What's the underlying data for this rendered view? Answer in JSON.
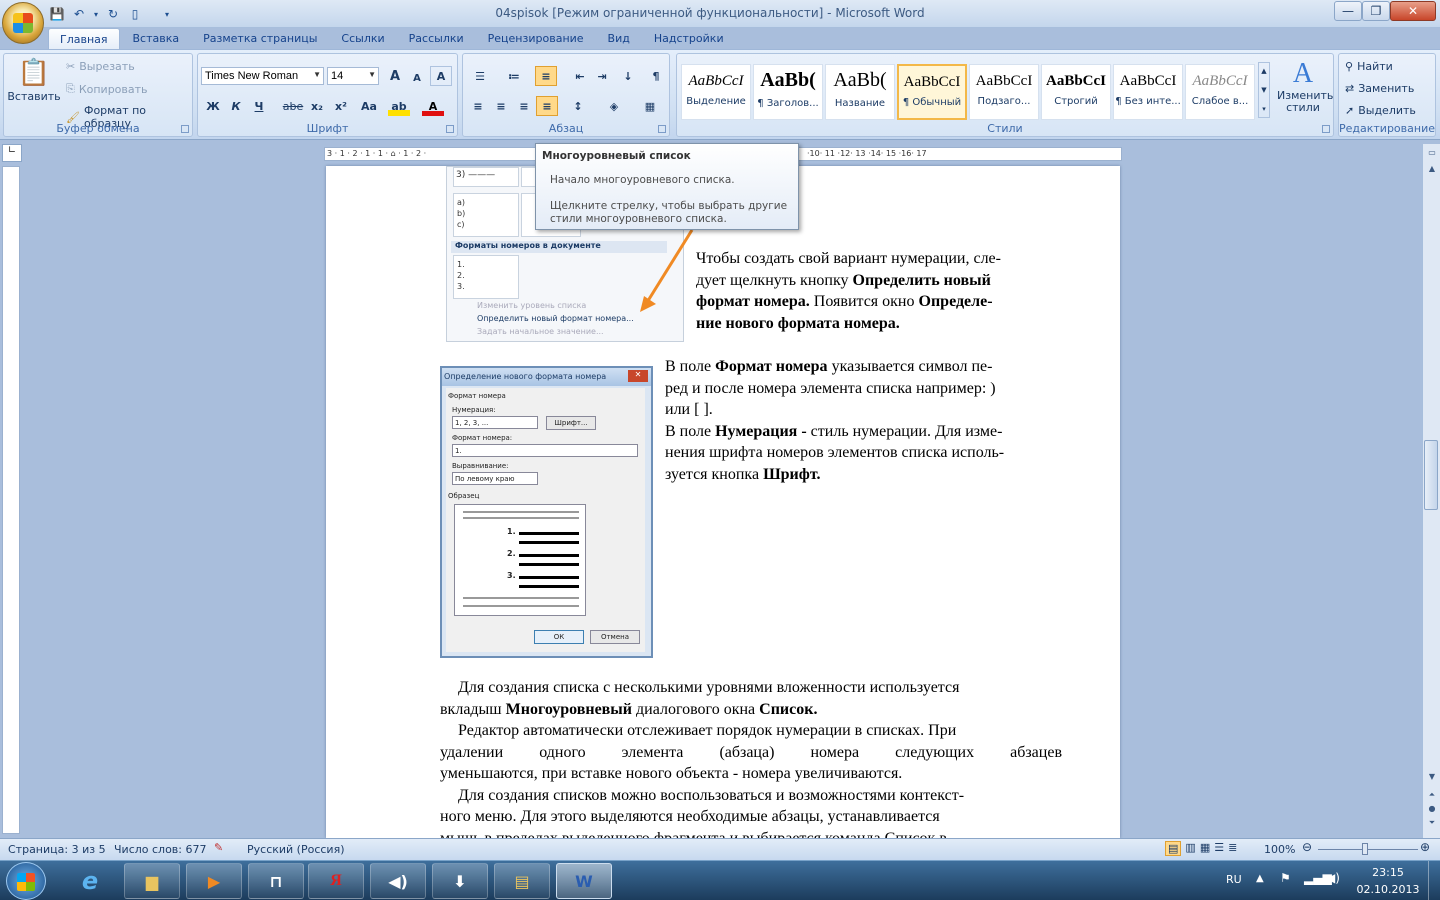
{
  "window": {
    "title": "04spisok [Режим ограниченной функциональности] - Microsoft Word",
    "min": "—",
    "max": "❐",
    "close": "✕"
  },
  "tabs": [
    "Главная",
    "Вставка",
    "Разметка страницы",
    "Ссылки",
    "Рассылки",
    "Рецензирование",
    "Вид",
    "Надстройки"
  ],
  "ribbon": {
    "clipboard": {
      "paste": "Вставить",
      "cut": "Вырезать",
      "copy": "Копировать",
      "format_painter": "Формат по образцу",
      "label": "Буфер обмена"
    },
    "font": {
      "name": "Times New Roman",
      "size": "14",
      "bold": "Ж",
      "italic": "К",
      "underline": "Ч",
      "strike": "abe",
      "sub": "x₂",
      "sup": "x²",
      "case": "Aa",
      "grow": "A",
      "shrink": "A",
      "clear": "A",
      "label": "Шрифт"
    },
    "paragraph": {
      "label": "Абзац"
    },
    "styles": {
      "label": "Стили",
      "tiles": [
        {
          "preview": "AaBbCcI",
          "name": "Выделение"
        },
        {
          "preview": "AaBb(",
          "name": "¶ Заголов..."
        },
        {
          "preview": "AaBb(",
          "name": "Название"
        },
        {
          "preview": "AaBbCcI",
          "name": "¶ Обычный"
        },
        {
          "preview": "AaBbCcI",
          "name": "Подзаго..."
        },
        {
          "preview": "AaBbCcI",
          "name": "Строгий"
        },
        {
          "preview": "AaBbCcI",
          "name": "¶ Без инте..."
        },
        {
          "preview": "AaBbCcI",
          "name": "Слабое в..."
        }
      ],
      "change_styles": "Изменить стили"
    },
    "editing": {
      "find": "Найти",
      "replace": "Заменить",
      "select": "Выделить",
      "label": "Редактирование"
    }
  },
  "ruler": {
    "marks": "3 · 1 · 2 · 1 · 1 · ⌂ · 1 · 2 ·",
    "marks_right": "·10· 11 ·12· 13 ·14· 15 ·16· 17"
  },
  "tooltip": {
    "title": "Многоуровневый список",
    "line1": "Начало многоуровневого списка.",
    "line2": "Щелкните стрелку, чтобы выбрать другие стили многоуровневого списка."
  },
  "doc": {
    "img1": {
      "items_a": [
        "а)",
        "b)",
        "c)"
      ],
      "section": "Форматы номеров в документе",
      "nums": [
        "1.",
        "2.",
        "3."
      ],
      "menu": [
        "Изменить уровень списка",
        "Определить новый формат номера...",
        "Задать начальное значение..."
      ]
    },
    "img2": {
      "title": "Определение нового формата номера",
      "group": "Формат номера",
      "numbering_label": "Нумерация:",
      "numbering_value": "1, 2, 3, ...",
      "font_btn": "Шрифт...",
      "format_label": "Формат номера:",
      "format_value": "1.",
      "align_label": "Выравнивание:",
      "align_value": "По левому краю",
      "sample_label": "Образец",
      "sample_nums": [
        "1.",
        "2.",
        "3."
      ],
      "ok": "ОК",
      "cancel": "Отмена"
    },
    "p1_a": "Чтобы создать свой вариант нумерации, сле-",
    "p1_b": "дует щелкнуть кнопку ",
    "p1_b_bold": "Определить новый",
    "p1_c_bold": "формат номера.",
    "p1_c": " Появится окно ",
    "p1_c_bold2": "Определе-",
    "p1_d_bold": "ние нового формата номера.",
    "p2_a1": "В поле ",
    "p2_a_bold": "Формат номера",
    "p2_a2": " указывается символ пе-",
    "p2_b": "ред и после номера элемента списка например: )",
    "p2_c": "или [ ].",
    "p3_a1": "В поле ",
    "p3_a_bold": "Нумерация -",
    "p3_a2": " стиль нумерации. Для изме-",
    "p3_b": "нения шрифта номеров элементов списка исполь-",
    "p3_c1": "зуется кнопка ",
    "p3_c_bold": "Шрифт.",
    "p4_a": "Для создания списка с несколькими уровнями вложенности используется",
    "p4_b1": "вкладыш ",
    "p4_b_bold": "Многоуровневый",
    "p4_b2": " диалогового окна ",
    "p4_b_bold2": "Список.",
    "p5_a": "Редактор автоматически отслеживает порядок нумерации в списках. При",
    "p5_b": "удалении одного элемента (абзаца) номера следующих абзацев",
    "p5_c": "уменьшаются, при вставке нового объекта - номера увеличиваются.",
    "p6_a": "Для создания списков можно воспользоваться и возможностями контекст-",
    "p6_b": "ного меню. Для этого выделяются необходимые абзацы, устанавливается",
    "p6_c": "мышь в пределах выделенного фрагмента и выбирается команда Список в"
  },
  "status": {
    "page": "Страница: 3 из 5",
    "words": "Число слов: 677",
    "lang": "Русский (Россия)",
    "zoom": "100%"
  },
  "taskbar": {
    "lang": "RU",
    "time": "23:15",
    "date": "02.10.2013"
  }
}
